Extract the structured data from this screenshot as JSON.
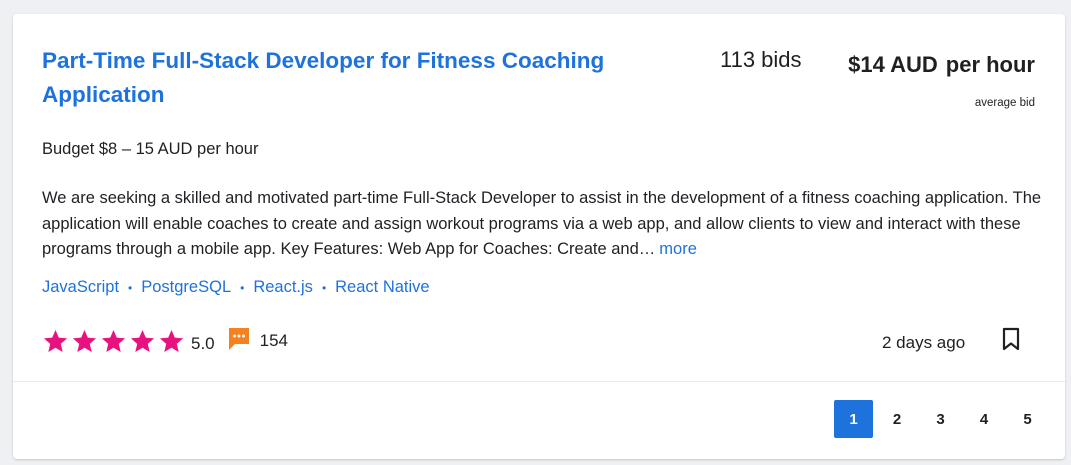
{
  "project": {
    "title": "Part-Time Full-Stack Developer for Fitness Coaching Application",
    "bids": "113 bids",
    "price_amount": "$14 AUD",
    "price_unit": "per hour",
    "price_caption": "average bid",
    "budget": "Budget $8 – 15 AUD per hour",
    "description": "We are seeking a skilled and motivated part-time Full-Stack Developer to assist in the development of a fitness coaching application. The application will enable coaches to create and assign workout programs via a web app, and allow clients to view and interact with these programs through a mobile app. Key Features: Web App for Coaches: Create and…",
    "more_label": "more",
    "skills": [
      "JavaScript",
      "PostgreSQL",
      "React.js",
      "React Native"
    ],
    "skill_separator": "•",
    "rating": {
      "score": "5.0",
      "stars": 5,
      "max_stars": 5,
      "star_color": "#e8117f"
    },
    "reviews": {
      "count": "154",
      "icon": "speech-bubble-icon",
      "icon_color": "#f5821f"
    },
    "posted": "2 days ago",
    "bookmark_icon": "bookmark-icon"
  },
  "pagination": {
    "pages": [
      "1",
      "2",
      "3",
      "4",
      "5"
    ],
    "active_page": "1",
    "accent_color": "#1e72dc"
  }
}
